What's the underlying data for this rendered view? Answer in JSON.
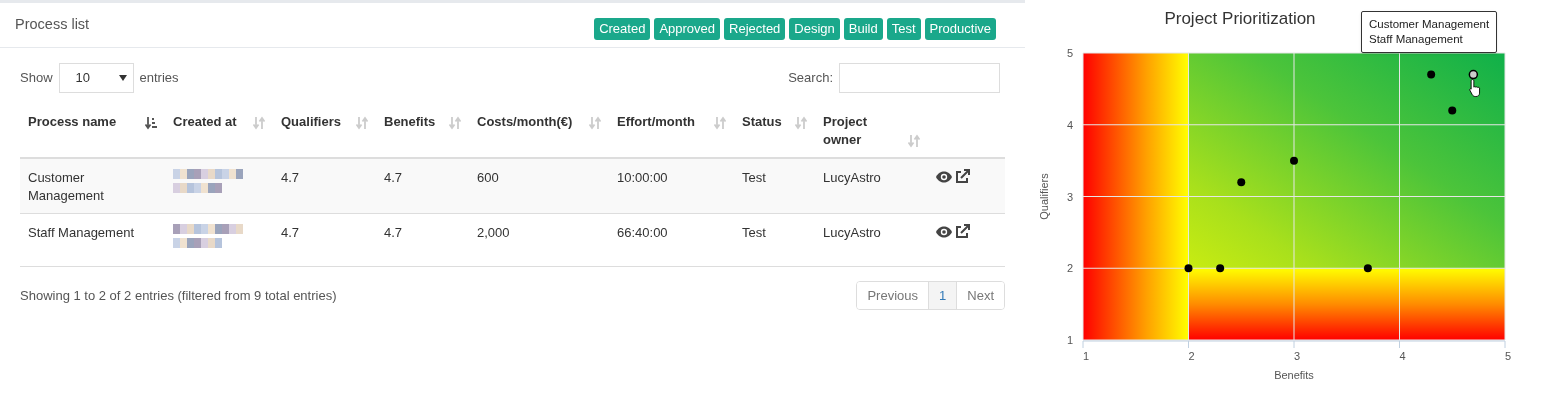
{
  "panel": {
    "title": "Process list",
    "filters": [
      {
        "label": "Created"
      },
      {
        "label": "Approved"
      },
      {
        "label": "Rejected"
      },
      {
        "label": "Design"
      },
      {
        "label": "Build"
      },
      {
        "label": "Test"
      },
      {
        "label": "Productive"
      }
    ]
  },
  "length_menu": {
    "before": "Show",
    "value": "10",
    "after": "entries"
  },
  "search": {
    "label": "Search:"
  },
  "table": {
    "columns": [
      {
        "label": "Process name",
        "sorted": true
      },
      {
        "label": "Created at",
        "sorted": false
      },
      {
        "label": "Qualifiers",
        "sorted": false
      },
      {
        "label": "Benefits",
        "sorted": false
      },
      {
        "label": "Costs/month(€)",
        "sorted": false
      },
      {
        "label": "Effort/month",
        "sorted": false
      },
      {
        "label": "Status",
        "sorted": false
      },
      {
        "label": "Project owner",
        "sorted": false
      }
    ],
    "rows": [
      {
        "cells": [
          "Customer Management",
          "",
          "4.7",
          "4.7",
          "600",
          "10:00:00",
          "Test",
          "LucyAstro"
        ]
      },
      {
        "cells": [
          "Staff Management",
          "",
          "4.7",
          "4.7",
          "2,000",
          "66:40:00",
          "Test",
          "LucyAstro"
        ]
      }
    ]
  },
  "info": "Showing 1 to 2 of 2 entries (filtered from 9 total entries)",
  "pagination": [
    {
      "label": "Previous",
      "selected": false
    },
    {
      "label": "1",
      "selected": true
    },
    {
      "label": "Next",
      "selected": false
    }
  ],
  "chart": {
    "chart_data": {
      "type": "scatter",
      "title": "Project Prioritization",
      "xlabel": "Benefits",
      "ylabel": "Qualifiers",
      "xlim": [
        1,
        5
      ],
      "ylim": [
        1,
        5
      ],
      "xticks": [
        1,
        2,
        3,
        4,
        5
      ],
      "yticks": [
        1,
        2,
        3,
        4,
        5
      ],
      "x": [
        2,
        2.3,
        3.7,
        2.5,
        3,
        4.3,
        4.5,
        4.7
      ],
      "series": [
        {
          "color": "#000000",
          "values": [
            2,
            2,
            2,
            3.2,
            3.5,
            4.7,
            4.2,
            4.7
          ]
        }
      ],
      "grid": true,
      "bands": [
        {
          "axis": "y",
          "from": 1,
          "to": 2
        },
        {
          "axis": "x",
          "from": 1,
          "to": 2
        }
      ],
      "annotations": [
        "Customer Management",
        "Staff Management"
      ]
    }
  }
}
